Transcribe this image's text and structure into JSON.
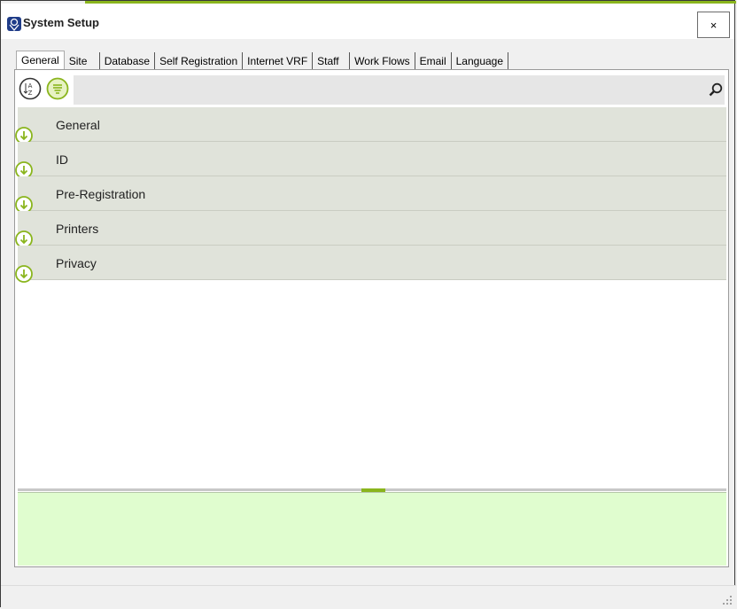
{
  "window": {
    "title": "System Setup",
    "close_label": "×",
    "accent_color": "#8ab51d"
  },
  "tabs": [
    {
      "label": "General",
      "active": true
    },
    {
      "label": "Site"
    },
    {
      "label": "Database"
    },
    {
      "label": "Self Registration"
    },
    {
      "label": "Internet VRF"
    },
    {
      "label": "Staff"
    },
    {
      "label": "Work Flows"
    },
    {
      "label": "Email"
    },
    {
      "label": "Language"
    }
  ],
  "toolbar": {
    "sort_alpha_icon": "sort-alphabetical-icon",
    "categorized_icon": "categorized-list-icon",
    "search_value": "",
    "search_icon": "search-icon"
  },
  "categories": [
    {
      "label": "General"
    },
    {
      "label": "ID"
    },
    {
      "label": "Pre-Registration"
    },
    {
      "label": "Printers"
    },
    {
      "label": "Privacy"
    }
  ],
  "colors": {
    "row_bg": "#e0e3da",
    "detail_bg": "#e0fdcf"
  }
}
